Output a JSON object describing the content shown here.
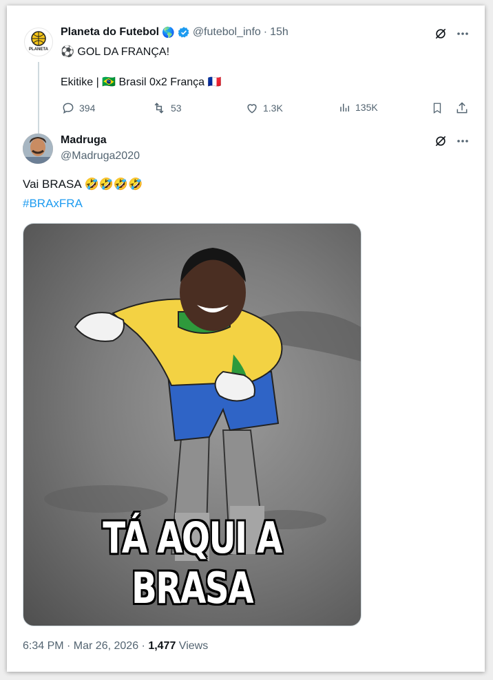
{
  "colors": {
    "accent": "#1d9bf0",
    "muted": "#536471",
    "verified": "#1d9bf0"
  },
  "quoted_tweet": {
    "display_name": "Planeta do Futebol",
    "handle": "@futebol_info",
    "time": "15h",
    "line1": "⚽ GOL DA FRANÇA!",
    "line2": "Ekitike | 🇧🇷 Brasil 0x2 França 🇫🇷",
    "avatar_text": "PLANETA",
    "globe_emoji": "🌎",
    "icons": [
      "grok-icon",
      "more-icon",
      "verified-badge-icon"
    ],
    "actions": {
      "replies": "394",
      "retweets": "53",
      "likes": "1.3K",
      "views": "135K"
    }
  },
  "main_tweet": {
    "display_name": "Madruga",
    "handle": "@Madruga2020",
    "text": "Vai BRASA 🤣🤣🤣🤣",
    "hashtag": "#BRAxFRA",
    "image_caption": "TÁ AQUI A BRASA",
    "timestamp": "6:34 PM · Mar 26, 2026 · ",
    "views_count": "1,477",
    "views_label": " Views"
  }
}
